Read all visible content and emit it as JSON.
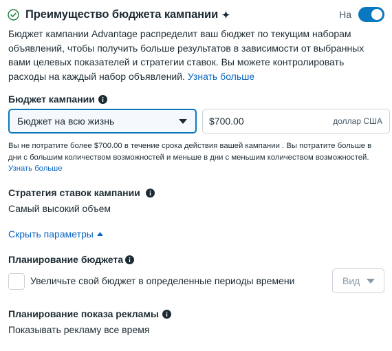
{
  "header": {
    "title": "Преимущество бюджета кампании",
    "toggle_label": "На",
    "toggle_on": true
  },
  "description": {
    "text": "Бюджет кампании Advantage распределит ваш бюджет по текущим наборам объявлений, чтобы получить больше результатов в зависимости от выбранных вами целевых показателей и стратегии ставок. Вы можете контролировать расходы на каждый набор объявлений. ",
    "link": "Узнать больше"
  },
  "budget": {
    "label": "Бюджет кампании",
    "type_selected": "Бюджет на всю жизнь",
    "amount": "$700.00",
    "currency": "доллар США",
    "note": "Вы не потратите более $700.00 в течение срока действия вашей кампании . Вы потратите больше в дни с большим количеством возможностей и меньше в дни с меньшим количеством возможностей. ",
    "note_link": "Узнать больше"
  },
  "bid_strategy": {
    "label": "Стратегия ставок кампании",
    "value": "Самый высокий объем"
  },
  "hide_params": {
    "label": "Скрыть параметры"
  },
  "budget_scheduling": {
    "label": "Планирование бюджета",
    "checkbox_label": "Увеличьте свой бюджет в определенные периоды времени",
    "view_label": "Вид"
  },
  "ad_scheduling": {
    "label": "Планирование показа рекламы",
    "value": "Показывать рекламу все время"
  },
  "colors": {
    "accent": "#0a78be",
    "link": "#0a66c2",
    "text": "#1c2b33"
  }
}
